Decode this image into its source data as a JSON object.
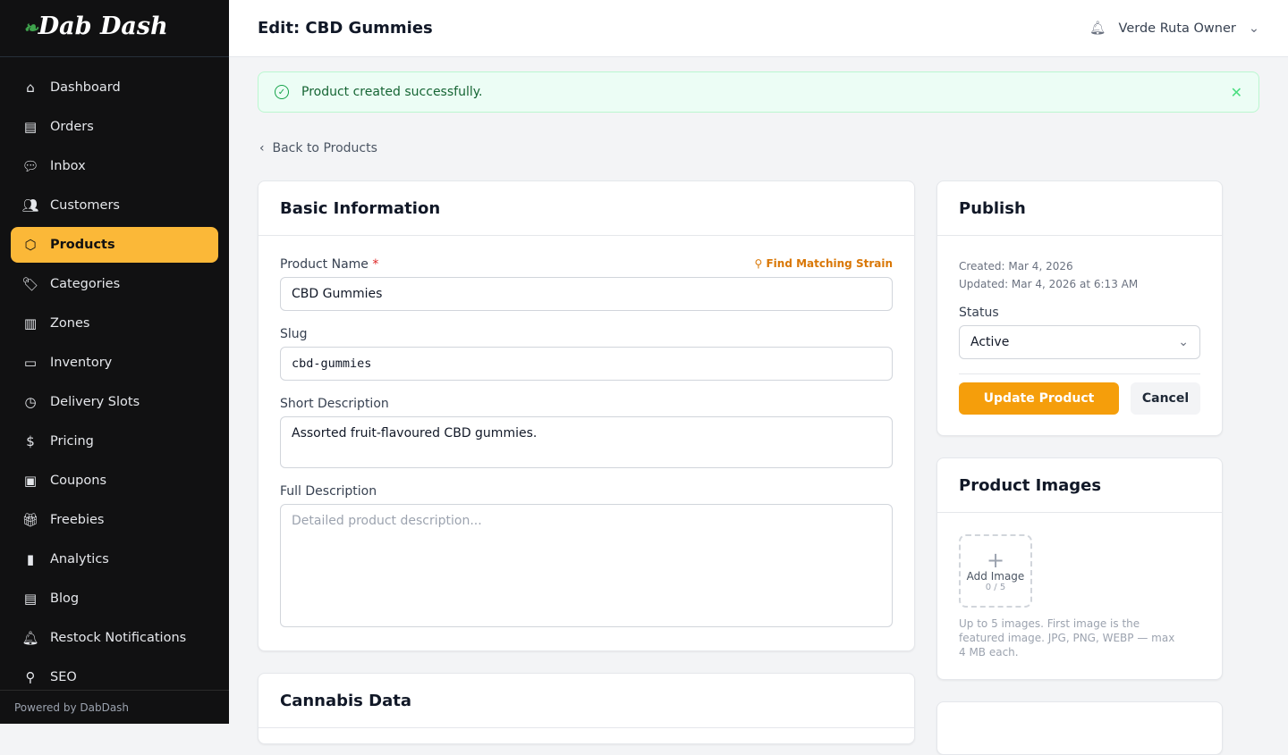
{
  "brand": "Dab Dash",
  "nav": [
    {
      "label": "Dashboard",
      "icon": "home-icon",
      "g": "⌂"
    },
    {
      "label": "Orders",
      "icon": "clipboard-icon",
      "g": "▤"
    },
    {
      "label": "Inbox",
      "icon": "chat-icon",
      "g": "💬"
    },
    {
      "label": "Customers",
      "icon": "users-icon",
      "g": "👥"
    },
    {
      "label": "Products",
      "icon": "box-icon",
      "g": "⬡"
    },
    {
      "label": "Categories",
      "icon": "tag-icon",
      "g": "🏷"
    },
    {
      "label": "Zones",
      "icon": "map-icon",
      "g": "▥"
    },
    {
      "label": "Inventory",
      "icon": "archive-icon",
      "g": "▭"
    },
    {
      "label": "Delivery Slots",
      "icon": "clock-icon",
      "g": "◷"
    },
    {
      "label": "Pricing",
      "icon": "dollar-icon",
      "g": "$"
    },
    {
      "label": "Coupons",
      "icon": "ticket-icon",
      "g": "▣"
    },
    {
      "label": "Freebies",
      "icon": "gift-icon",
      "g": "🎁"
    },
    {
      "label": "Analytics",
      "icon": "chart-icon",
      "g": "▮"
    },
    {
      "label": "Blog",
      "icon": "newspaper-icon",
      "g": "▤"
    },
    {
      "label": "Restock Notifications",
      "icon": "bell-icon",
      "g": "🔔"
    },
    {
      "label": "SEO",
      "icon": "search-icon",
      "g": "⚲"
    }
  ],
  "powered": "Powered by DabDash",
  "header": {
    "title": "Edit: CBD Gummies",
    "user": "Verde Ruta Owner"
  },
  "alert": "Product created successfully.",
  "back": "Back to Products",
  "basic": {
    "title": "Basic Information",
    "name_label": "Product Name",
    "required": "*",
    "find": "Find Matching Strain",
    "name": "CBD Gummies",
    "slug_label": "Slug",
    "slug": "cbd-gummies",
    "short_label": "Short Description",
    "short": "Assorted fruit-flavoured CBD gummies.",
    "full_label": "Full Description",
    "full_placeholder": "Detailed product description..."
  },
  "cannabis": {
    "title": "Cannabis Data"
  },
  "publish": {
    "title": "Publish",
    "created": "Created: Mar 4, 2026",
    "updated": "Updated: Mar 4, 2026 at 6:13 AM",
    "status_label": "Status",
    "status": "Active",
    "update": "Update Product",
    "cancel": "Cancel"
  },
  "images": {
    "title": "Product Images",
    "add": "Add Image",
    "count": "0 / 5",
    "help": "Up to 5 images. First image is the featured image. JPG, PNG, WEBP — max 4 MB each."
  },
  "colors": {
    "accent": "#f59e0b",
    "active_nav": "#fbb838"
  }
}
